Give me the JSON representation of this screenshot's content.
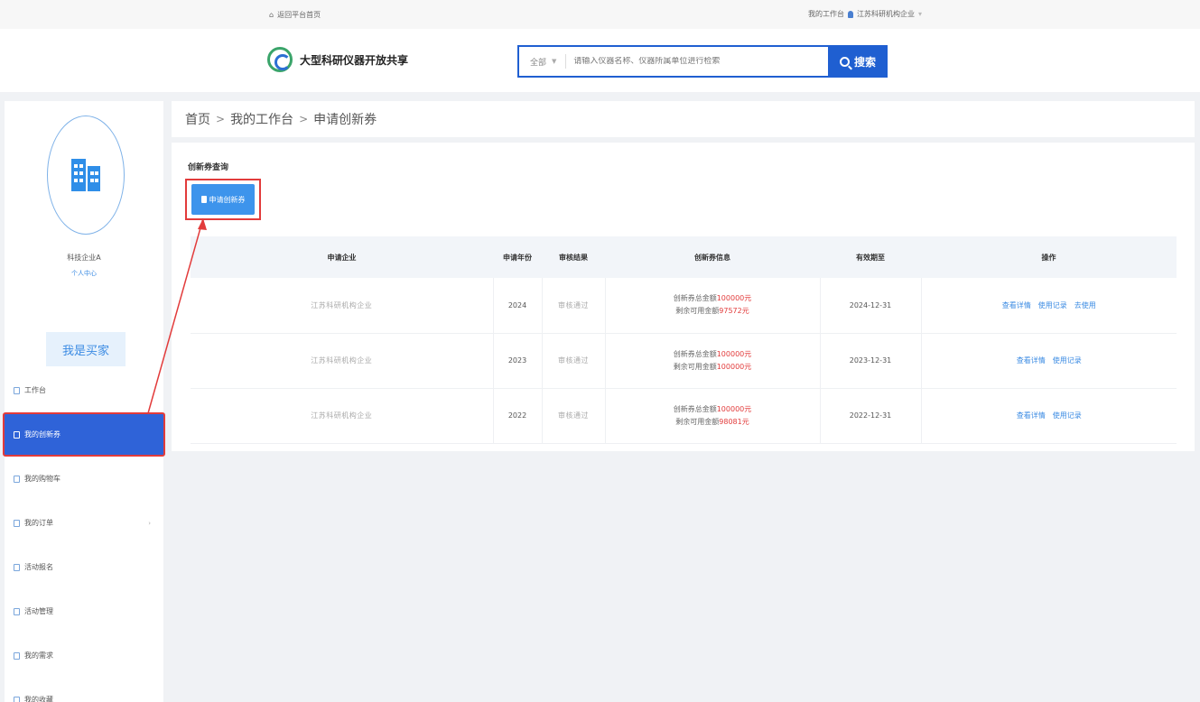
{
  "topbar": {
    "home_link": "返回平台首页",
    "workspace_link": "我的工作台",
    "user_name": "江苏科研机构企业"
  },
  "header": {
    "logo_text": "大型科研仪器开放共享",
    "search": {
      "scope": "全部",
      "placeholder": "请输入仪器名称、仪器所属单位进行检索",
      "button_label": "搜索"
    }
  },
  "sidebar": {
    "org_name": "科技企业A",
    "org_subtitle": "个人中心",
    "role_button": "我是买家",
    "items": [
      {
        "label": "工作台",
        "active": false,
        "has_submenu": false
      },
      {
        "label": "我的创新券",
        "active": true,
        "has_submenu": false
      },
      {
        "label": "我的购物车",
        "active": false,
        "has_submenu": false
      },
      {
        "label": "我的订单",
        "active": false,
        "has_submenu": true
      },
      {
        "label": "活动报名",
        "active": false,
        "has_submenu": false
      },
      {
        "label": "活动管理",
        "active": false,
        "has_submenu": false
      },
      {
        "label": "我的需求",
        "active": false,
        "has_submenu": false
      },
      {
        "label": "我的收藏",
        "active": false,
        "has_submenu": false
      }
    ]
  },
  "breadcrumb": {
    "home": "首页",
    "workspace": "我的工作台",
    "current": "申请创新券"
  },
  "panel": {
    "title": "创新券查询",
    "apply_button": "申请创新券"
  },
  "table": {
    "headers": [
      "申请企业",
      "申请年份",
      "审核结果",
      "创新券信息",
      "有效期至",
      "操作"
    ],
    "rows": [
      {
        "company": "江苏科研机构企业",
        "year": "2024",
        "status": "审核通过",
        "total_label": "创新券总金额",
        "total_value": "100000元",
        "remain_label": "剩余可用金额",
        "remain_value": "97572元",
        "expiry": "2024-12-31",
        "ops": [
          "查看详情",
          "使用记录",
          "去使用"
        ]
      },
      {
        "company": "江苏科研机构企业",
        "year": "2023",
        "status": "审核通过",
        "total_label": "创新券总金额",
        "total_value": "100000元",
        "remain_label": "剩余可用金额",
        "remain_value": "100000元",
        "expiry": "2023-12-31",
        "ops": [
          "查看详情",
          "使用记录"
        ]
      },
      {
        "company": "江苏科研机构企业",
        "year": "2022",
        "status": "审核通过",
        "total_label": "创新券总金额",
        "total_value": "100000元",
        "remain_label": "剩余可用金额",
        "remain_value": "98081元",
        "expiry": "2022-12-31",
        "ops": [
          "查看详情",
          "使用记录"
        ]
      }
    ]
  },
  "colors": {
    "primary": "#1f5fd1",
    "active_nav": "#2f63d8",
    "highlight": "#e23b3b",
    "link": "#3b8be3"
  }
}
